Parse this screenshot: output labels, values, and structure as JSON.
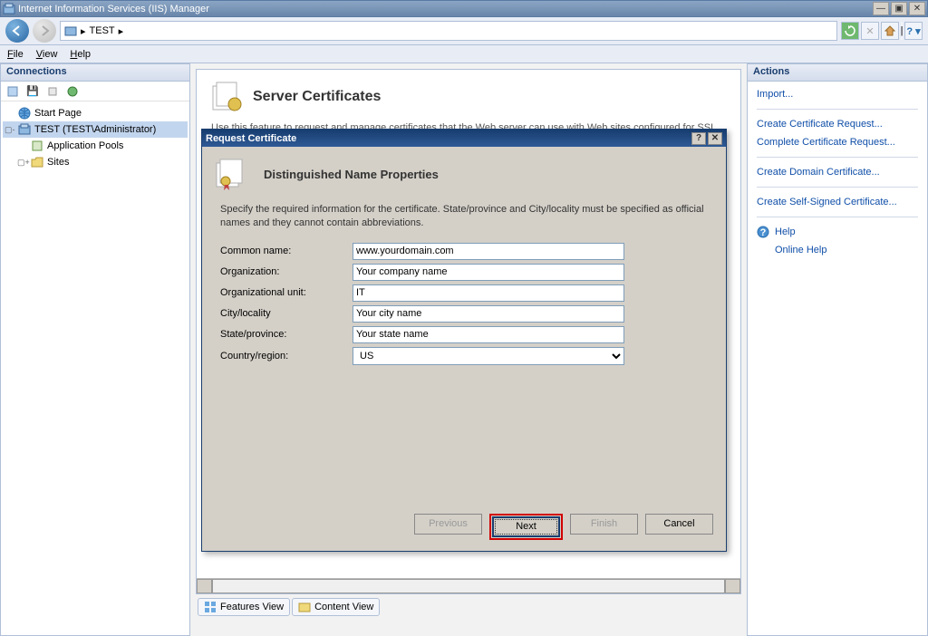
{
  "window": {
    "title": "Internet Information Services (IIS) Manager"
  },
  "breadcrumb": {
    "root_arrow": "▸",
    "item": "TEST",
    "arrow2": "▸"
  },
  "menu": {
    "file": "File",
    "view": "View",
    "help": "Help"
  },
  "connections": {
    "header": "Connections",
    "start_page": "Start Page",
    "server": "TEST (TEST\\Administrator)",
    "app_pools": "Application Pools",
    "sites": "Sites"
  },
  "feature": {
    "title": "Server Certificates",
    "description": "Use this feature to request and manage certificates that the Web server can use with Web sites configured for SSL."
  },
  "actions": {
    "header": "Actions",
    "import": "Import...",
    "create_request": "Create Certificate Request...",
    "complete_request": "Complete Certificate Request...",
    "create_domain": "Create Domain Certificate...",
    "create_selfsigned": "Create Self-Signed Certificate...",
    "help": "Help",
    "online_help": "Online Help"
  },
  "view_tabs": {
    "features": "Features View",
    "content": "Content View"
  },
  "modal": {
    "title": "Request Certificate",
    "heading": "Distinguished Name Properties",
    "description": "Specify the required information for the certificate. State/province and City/locality must be specified as official names and they cannot contain abbreviations.",
    "labels": {
      "common_name": "Common name:",
      "organization": "Organization:",
      "org_unit": "Organizational unit:",
      "city": "City/locality",
      "state": "State/province:",
      "country": "Country/region:"
    },
    "values": {
      "common_name": "www.yourdomain.com",
      "organization": "Your company name",
      "org_unit": "IT",
      "city": "Your city name",
      "state": "Your state name",
      "country": "US"
    },
    "buttons": {
      "previous": "Previous",
      "next": "Next",
      "finish": "Finish",
      "cancel": "Cancel"
    }
  }
}
